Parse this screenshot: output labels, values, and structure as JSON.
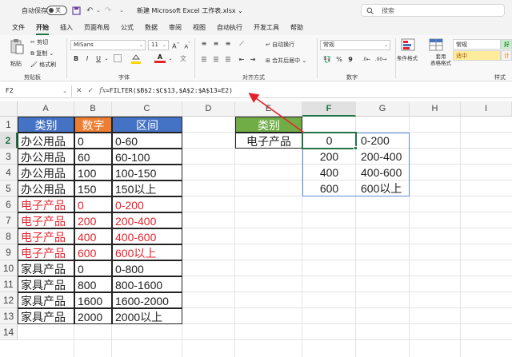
{
  "titlebar": {
    "autosave_label": "自动保存",
    "toggle_text": "关",
    "document_title": "新建 Microsoft Excel 工作表.xlsx ⌄",
    "search_placeholder": "搜索"
  },
  "menu": {
    "tabs": [
      "文件",
      "开始",
      "插入",
      "页面布局",
      "公式",
      "数据",
      "审阅",
      "视图",
      "自动执行",
      "开发工具",
      "帮助"
    ],
    "active_tab": "开始"
  },
  "ribbon": {
    "paste_label": "粘贴",
    "cut_label": "剪切",
    "copy_label": "复制 ⌄",
    "format_painter_label": "格式刷",
    "clipboard_group": "剪贴板",
    "font_name": "MiSans",
    "font_size": "11",
    "font_group": "字体",
    "wrap_text_label": "自动换行",
    "merge_center_label": "合并后居中 ⌄",
    "alignment_group": "对齐方式",
    "number_format": "常规",
    "number_group": "数字",
    "conditional_format_label": "条件格式",
    "table_format_label": "套用\n表格格式",
    "style_normal": "常规",
    "style_neutral": "适中",
    "style_bad_partial": "好",
    "style_extra_partial": "计",
    "styles_group": "样式",
    "font_color_hex": "#e3222b",
    "fill_color_hex": "#ffd400"
  },
  "formula_bar": {
    "name_box": "F2",
    "formula": "=FILTER($B$2:$C$13,$A$2:$A$13=E2)"
  },
  "sheet": {
    "columns": [
      "A",
      "B",
      "C",
      "D",
      "E",
      "F",
      "G",
      "H",
      "I"
    ],
    "selected_column": "F",
    "selected_row": "2",
    "rows": [
      "1",
      "2",
      "3",
      "4",
      "5",
      "6",
      "7",
      "8",
      "9",
      "10",
      "11",
      "12",
      "13",
      "14"
    ],
    "header": {
      "category": "类别",
      "number": "数字",
      "range": "区间"
    },
    "data": [
      {
        "category": "办公用品",
        "number": "0",
        "range": "0-60",
        "highlight": false
      },
      {
        "category": "办公用品",
        "number": "60",
        "range": "60-100",
        "highlight": false
      },
      {
        "category": "办公用品",
        "number": "100",
        "range": "100-150",
        "highlight": false
      },
      {
        "category": "办公用品",
        "number": "150",
        "range": "150以上",
        "highlight": false
      },
      {
        "category": "电子产品",
        "number": "0",
        "range": "0-200",
        "highlight": true
      },
      {
        "category": "电子产品",
        "number": "200",
        "range": "200-400",
        "highlight": true
      },
      {
        "category": "电子产品",
        "number": "400",
        "range": "400-600",
        "highlight": true
      },
      {
        "category": "电子产品",
        "number": "600",
        "range": "600以上",
        "highlight": true
      },
      {
        "category": "家具产品",
        "number": "0",
        "range": "0-800",
        "highlight": false
      },
      {
        "category": "家具产品",
        "number": "800",
        "range": "800-1600",
        "highlight": false
      },
      {
        "category": "家具产品",
        "number": "1600",
        "range": "1600-2000",
        "highlight": false
      },
      {
        "category": "家具产品",
        "number": "2000",
        "range": "2000以上",
        "highlight": false
      }
    ],
    "lookup": {
      "header": "类别",
      "value": "电子产品"
    },
    "results": [
      {
        "number": "0",
        "range": "0-200"
      },
      {
        "number": "200",
        "range": "200-400"
      },
      {
        "number": "400",
        "range": "400-600"
      },
      {
        "number": "600",
        "range": "600以上"
      }
    ],
    "colors": {
      "header_blue": "#4472c4",
      "header_orange": "#ed7d31",
      "header_green": "#70ad47",
      "highlight_red": "#e3222b",
      "selection_green": "#217346"
    }
  }
}
